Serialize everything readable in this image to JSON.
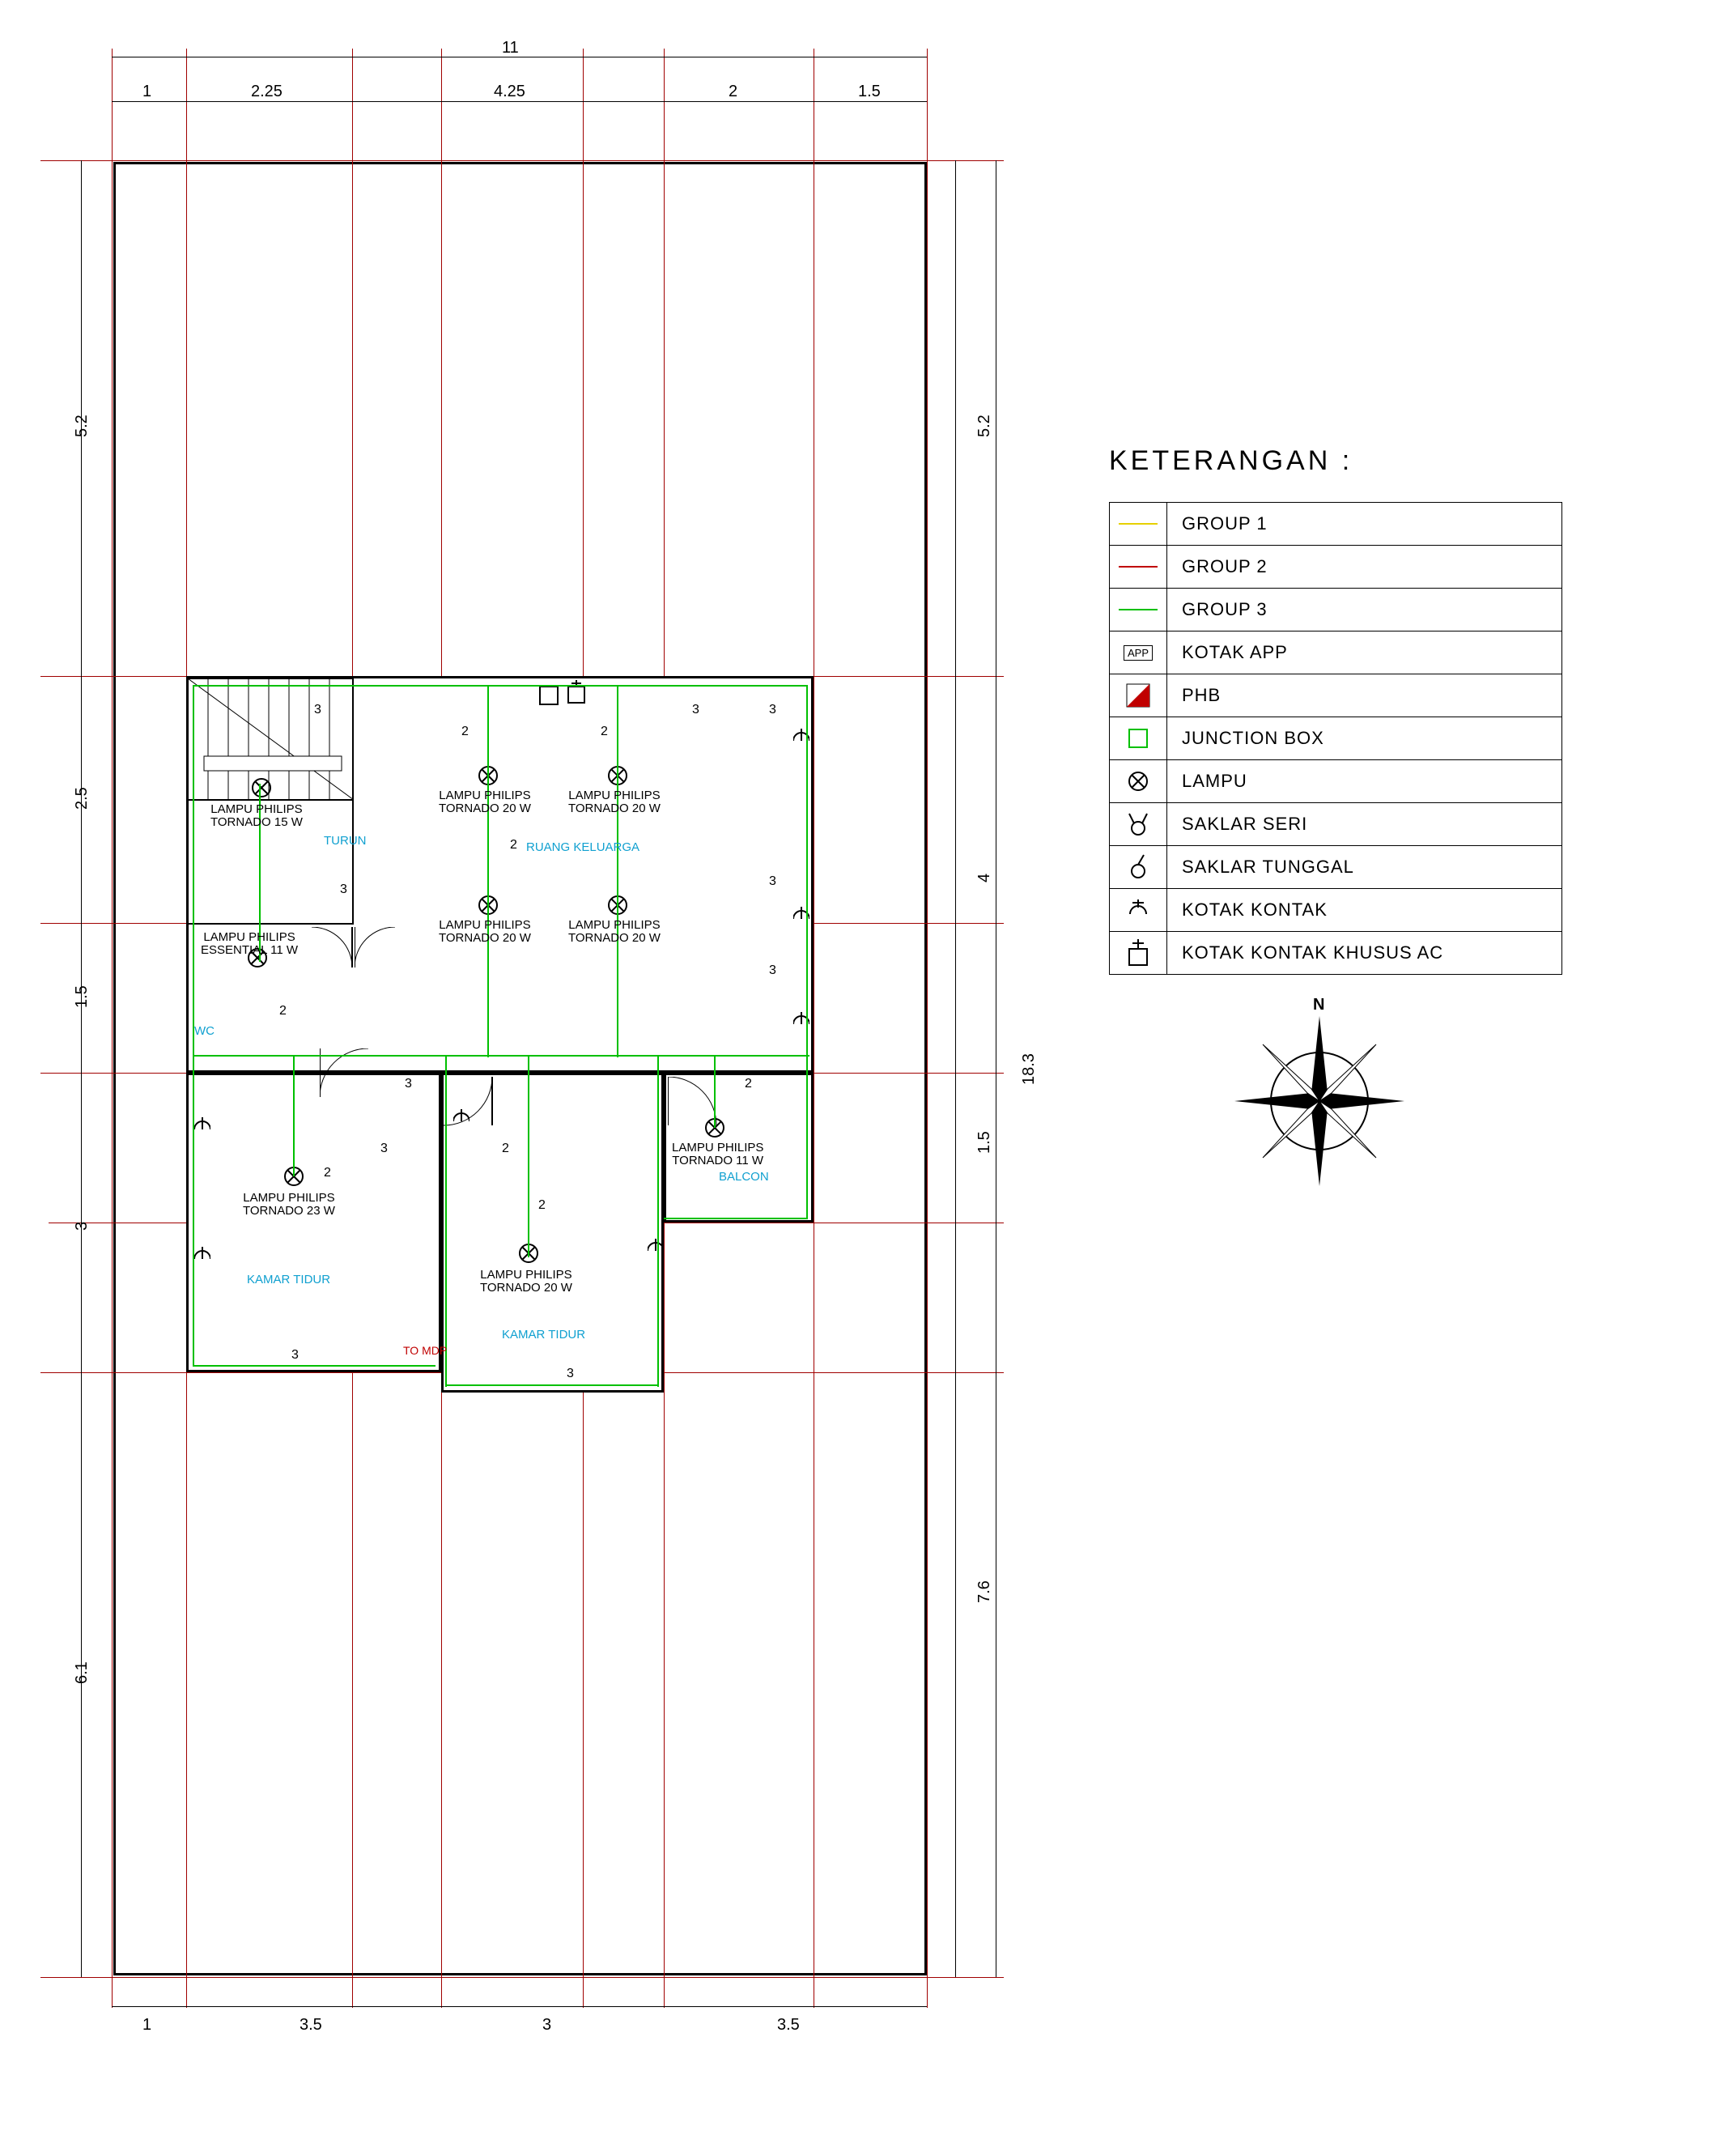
{
  "dims_top": {
    "overall": "11",
    "a": "1",
    "b": "2.25",
    "c": "4.25",
    "d": "2",
    "e": "1.5"
  },
  "dims_bottom": {
    "a": "1",
    "b": "3.5",
    "c": "3",
    "d": "3.5"
  },
  "dims_left": {
    "a": "5.2",
    "b": "2.5",
    "c": "1.5",
    "d": "3",
    "e": "6.1"
  },
  "dims_right": {
    "overall": "18.3",
    "a": "5.2",
    "b": "4",
    "c": "1.5",
    "d": "7.6"
  },
  "rooms": {
    "wc": "WC",
    "turun": "TURUN",
    "rk": "RUANG KELUARGA",
    "kt1": "KAMAR TIDUR",
    "kt2": "KAMAR TIDUR",
    "balcon": "BALCON"
  },
  "lamps": {
    "l_stair": "LAMPU PHILIPS\nTORNADO 15 W",
    "l_ess": "LAMPU PHILIPS\nESSENTIAL 11 W",
    "l_rk1": "LAMPU PHILIPS\nTORNADO 20 W",
    "l_rk2": "LAMPU PHILIPS\nTORNADO 20 W",
    "l_rk3": "LAMPU PHILIPS\nTORNADO 20 W",
    "l_rk4": "LAMPU PHILIPS\nTORNADO 20 W",
    "l_kt1": "LAMPU PHILIPS\nTORNADO 23 W",
    "l_kt2": "LAMPU PHILIPS\nTORNADO 20 W",
    "l_balc": "LAMPU PHILIPS\nTORNADO 11 W"
  },
  "circuit": {
    "n2": "2",
    "n3": "3"
  },
  "notes": {
    "tomdp": "TO MDP"
  },
  "legend": {
    "title": "KETERANGAN :",
    "rows": [
      {
        "color": "#e6d000",
        "label": "GROUP 1"
      },
      {
        "color": "#c00000",
        "label": "GROUP 2"
      },
      {
        "color": "#00c000",
        "label": "GROUP 3"
      },
      {
        "icon": "app",
        "label": "KOTAK APP"
      },
      {
        "icon": "phb",
        "label": "PHB"
      },
      {
        "icon": "jbox",
        "label": "JUNCTION BOX"
      },
      {
        "icon": "lamp",
        "label": "LAMPU"
      },
      {
        "icon": "sseri",
        "label": "SAKLAR SERI"
      },
      {
        "icon": "stung",
        "label": "SAKLAR TUNGGAL"
      },
      {
        "icon": "kk",
        "label": "KOTAK KONTAK"
      },
      {
        "icon": "kkac",
        "label": "KOTAK KONTAK KHUSUS AC"
      }
    ],
    "north": "N"
  },
  "colors": {
    "grid": "#a00000",
    "g3": "#00c000",
    "room": "#10a0d0"
  }
}
